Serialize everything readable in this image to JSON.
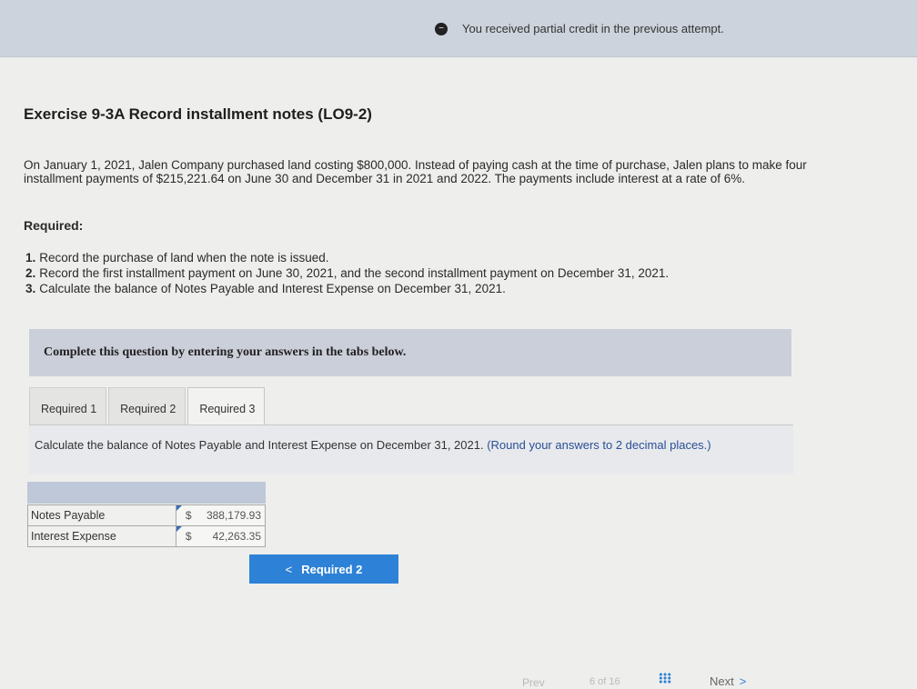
{
  "banner": {
    "message": "You received partial credit in the previous attempt."
  },
  "exercise": {
    "title": "Exercise 9-3A Record installment notes (LO9-2)",
    "description": "On January 1, 2021, Jalen Company purchased land costing $800,000. Instead of paying cash at the time of purchase, Jalen plans to make four installment payments of $215,221.64 on June 30 and December 31 in 2021 and 2022. The payments include interest at a rate of 6%.",
    "required_heading": "Required:",
    "requirements": [
      {
        "num": "1.",
        "text": "Record the purchase of land when the note is issued."
      },
      {
        "num": "2.",
        "text": "Record the first installment payment on June 30, 2021, and the second installment payment on December 31, 2021."
      },
      {
        "num": "3.",
        "text": "Calculate the balance of Notes Payable and Interest Expense on December 31, 2021."
      }
    ]
  },
  "instructions_box": "Complete this question by entering your answers in the tabs below.",
  "tabs": [
    {
      "label": "Required 1"
    },
    {
      "label": "Required 2"
    },
    {
      "label": "Required 3"
    }
  ],
  "panel": {
    "instruction": "Calculate the balance of Notes Payable and Interest Expense on December 31, 2021.",
    "note": "(Round your answers to 2 decimal places.)"
  },
  "answers": [
    {
      "label": "Notes Payable",
      "currency": "$",
      "value": "388,179.93"
    },
    {
      "label": "Interest Expense",
      "currency": "$",
      "value": "42,263.35"
    }
  ],
  "prev_button": {
    "chevron": "<",
    "label": "Required 2"
  },
  "footer": {
    "prev_label": "Prev",
    "page_text": "6 of 16",
    "next_label": "Next",
    "next_chevron": ">"
  }
}
